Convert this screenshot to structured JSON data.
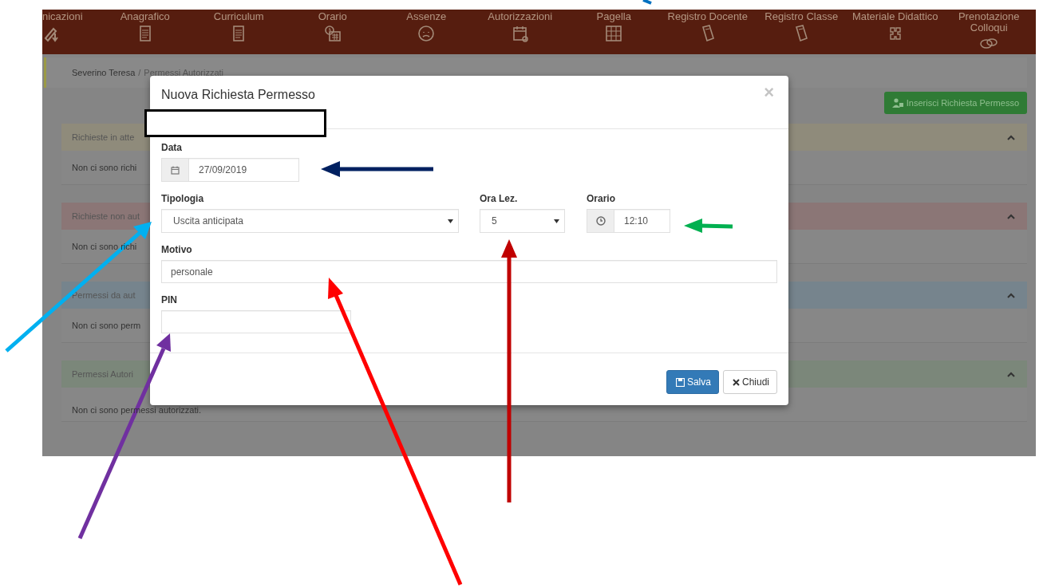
{
  "nav": {
    "items": [
      {
        "label": "nicazioni"
      },
      {
        "label": "Anagrafico"
      },
      {
        "label": "Curriculum"
      },
      {
        "label": "Orario"
      },
      {
        "label": "Assenze"
      },
      {
        "label": "Autorizzazioni"
      },
      {
        "label": "Pagella"
      },
      {
        "label": "Registro Docente"
      },
      {
        "label": "Registro Classe"
      },
      {
        "label": "Materiale Didattico"
      },
      {
        "label": "Prenotazione Colloqui"
      }
    ]
  },
  "breadcrumb": {
    "items": [
      "Severino Teresa",
      "Permessi Autorizzati"
    ],
    "separator": "/"
  },
  "insert_button": "Inserisci Richiesta Permesso",
  "panels": [
    {
      "title": "Richieste in atte",
      "message": "Non ci sono richi",
      "color": "#8f8b7b"
    },
    {
      "title": "Richieste non aut",
      "message": "Non ci sono richi",
      "color": "#8b7676"
    },
    {
      "title": "Permessi da aut",
      "message": "Non ci sono perm",
      "color": "#76848d"
    },
    {
      "title": "Permessi Autori",
      "message": "Non ci sono permessi autorizzati.",
      "color": "#7b877a"
    }
  ],
  "modal": {
    "title": "Nuova Richiesta Permesso",
    "close": "×",
    "data": {
      "label": "Data",
      "value": "27/09/2019"
    },
    "tipologia": {
      "label": "Tipologia",
      "value": "Uscita anticipata"
    },
    "ora_lez": {
      "label": "Ora Lez.",
      "value": "5"
    },
    "orario": {
      "label": "Orario",
      "value": "12:10"
    },
    "motivo": {
      "label": "Motivo",
      "value": "personale"
    },
    "pin": {
      "label": "PIN"
    },
    "buttons": [
      {
        "label": "Salva",
        "kind": "primary"
      },
      {
        "label": "Chiudi",
        "kind": "default"
      }
    ]
  }
}
